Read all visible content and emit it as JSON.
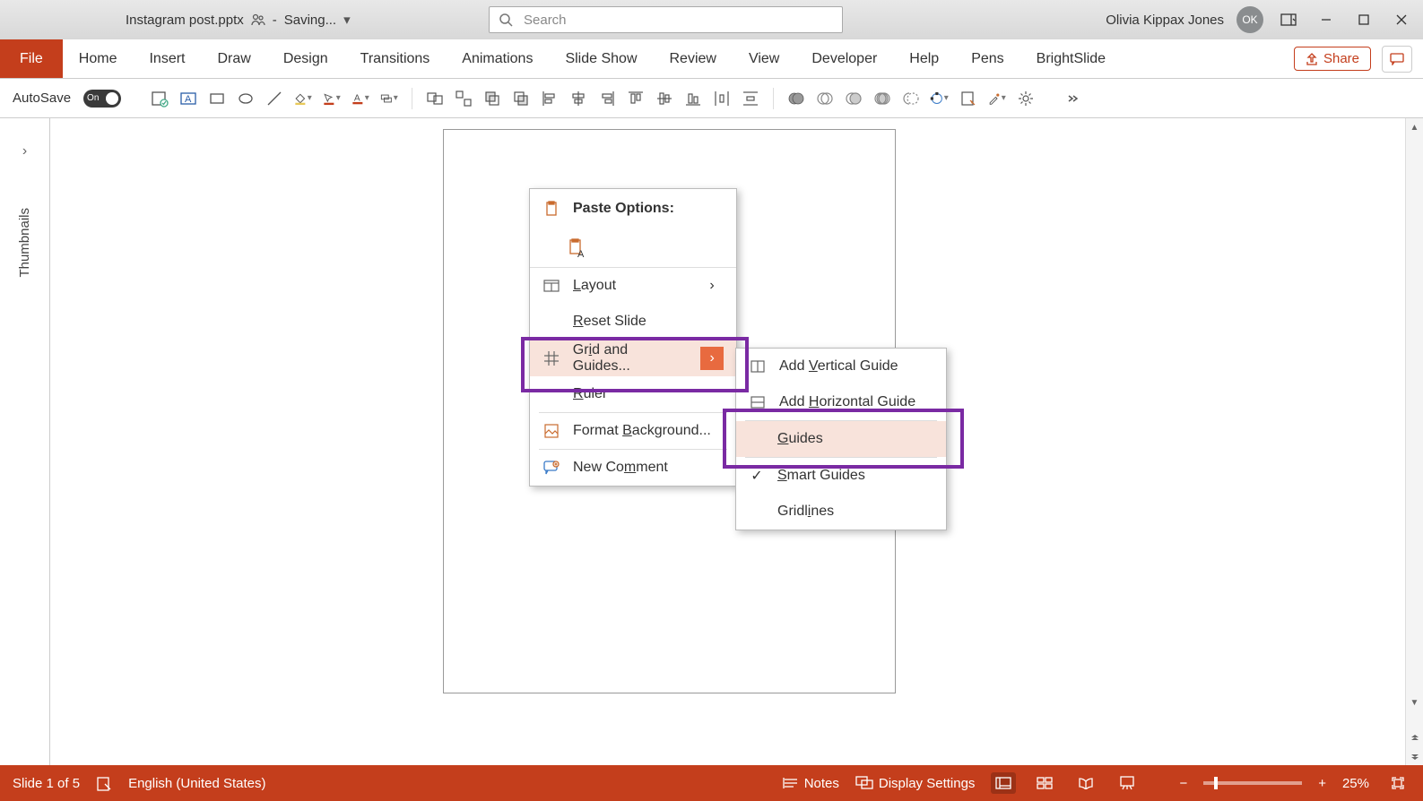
{
  "title": {
    "filename": "Instagram post.pptx",
    "saving_status": "Saving...",
    "separator": "-"
  },
  "search": {
    "placeholder": "Search"
  },
  "user": {
    "name": "Olivia Kippax Jones",
    "initials": "OK"
  },
  "ribbon": {
    "tabs": [
      "File",
      "Home",
      "Insert",
      "Draw",
      "Design",
      "Transitions",
      "Animations",
      "Slide Show",
      "Review",
      "View",
      "Developer",
      "Help",
      "Pens",
      "BrightSlide"
    ],
    "share": "Share"
  },
  "qat": {
    "autosave_label": "AutoSave",
    "autosave_state": "On"
  },
  "thumbnails": {
    "label": "Thumbnails"
  },
  "context_menu": {
    "paste_header": "Paste Options:",
    "layout": "Layout",
    "reset_slide": "Reset Slide",
    "grid_guides": "Grid and Guides...",
    "ruler": "Ruler",
    "format_bg": "Format Background...",
    "new_comment": "New Comment"
  },
  "submenu": {
    "add_vertical": "Add Vertical Guide",
    "add_horizontal": "Add Horizontal Guide",
    "guides": "Guides",
    "smart_guides": "Smart Guides",
    "gridlines": "Gridlines"
  },
  "status": {
    "slide_of": "Slide 1 of 5",
    "language": "English (United States)",
    "notes": "Notes",
    "display_settings": "Display Settings",
    "zoom": "25%"
  }
}
